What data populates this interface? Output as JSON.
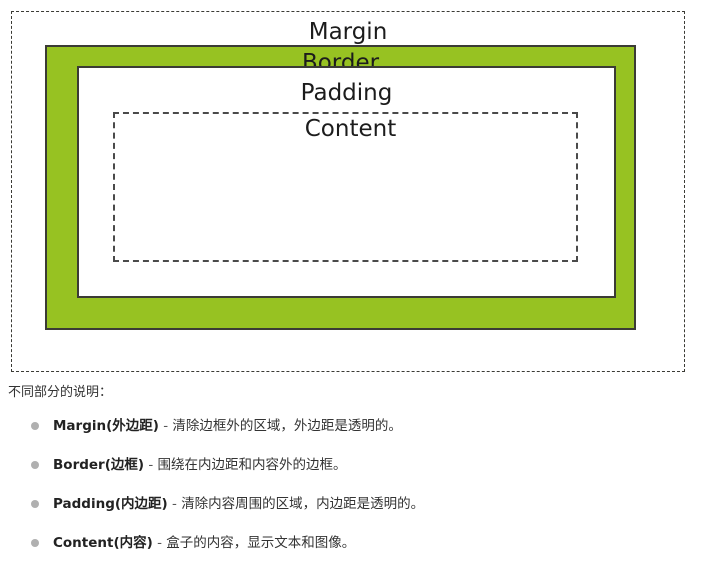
{
  "diagram": {
    "name": "css-box-model",
    "layers": {
      "margin_label": "Margin",
      "border_label": "Border",
      "padding_label": "Padding",
      "content_label": "Content"
    },
    "colors": {
      "border_fill": "#97c222",
      "outline": "#3b3b35",
      "content_outline": "#4a4a4a",
      "background": "#ffffff"
    }
  },
  "explanation": {
    "heading": "不同部分的说明：",
    "items": [
      {
        "term": "Margin(外边距)",
        "separator": "-",
        "description": "清除边框外的区域，外边距是透明的。"
      },
      {
        "term": "Border(边框)",
        "separator": "-",
        "description": "围绕在内边距和内容外的边框。"
      },
      {
        "term": "Padding(内边距)",
        "separator": "-",
        "description": "清除内容周围的区域，内边距是透明的。"
      },
      {
        "term": "Content(内容)",
        "separator": "-",
        "description": "盒子的内容，显示文本和图像。"
      }
    ]
  }
}
